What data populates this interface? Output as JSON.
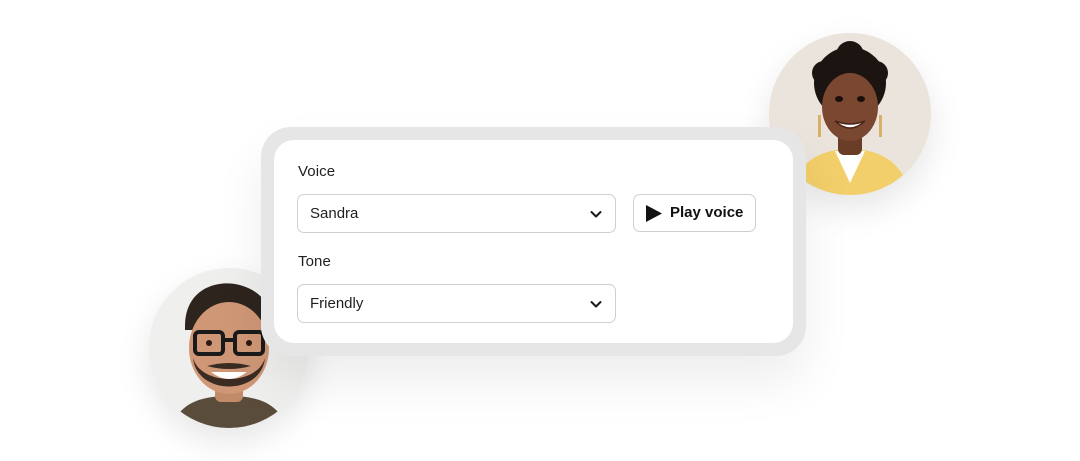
{
  "voice": {
    "label": "Voice",
    "selected": "Sandra",
    "play_button_label": "Play voice"
  },
  "tone": {
    "label": "Tone",
    "selected": "Friendly"
  },
  "icons": {
    "dropdown": "chevron-down-icon",
    "play": "play-icon"
  },
  "avatars": [
    {
      "role": "woman-portrait"
    },
    {
      "role": "man-portrait"
    }
  ],
  "colors": {
    "card_frame": "#e6e6e6",
    "card_surface": "#ffffff",
    "field_border": "#cfcfcf",
    "text": "#1f1f1f"
  }
}
